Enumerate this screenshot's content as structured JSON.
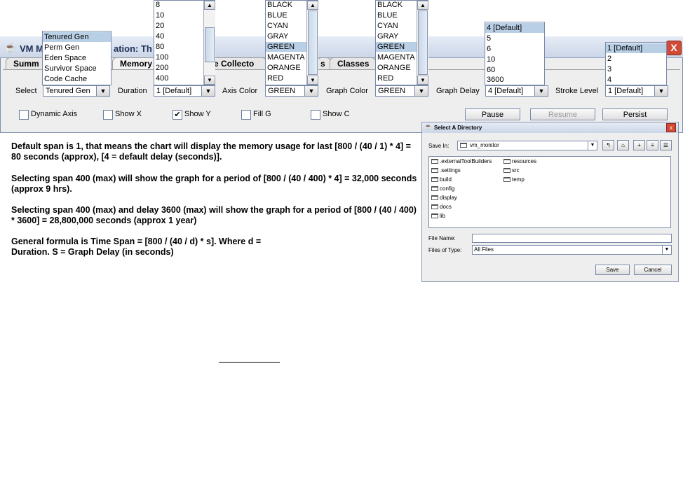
{
  "window": {
    "title_left": "VM M",
    "title_right": "ation: Th",
    "close_glyph": "X"
  },
  "tabs": [
    "Summ",
    "Memory",
    "age Collecto",
    "s",
    "Classes"
  ],
  "controls": {
    "select_label": "Select",
    "select_value": "Tenured Gen",
    "duration_label": "Duration",
    "duration_value": "1 [Default]",
    "axis_color_label": "Axis Color",
    "axis_color_value": "GREEN",
    "graph_color_label": "Graph Color",
    "graph_color_value": "GREEN",
    "graph_delay_label": "Graph Delay",
    "graph_delay_value": "4 [Default]",
    "stroke_level_label": "Stroke Level",
    "stroke_level_value": "1 [Default]"
  },
  "checkboxes": [
    {
      "label": "Dynamic Axis",
      "checked": false
    },
    {
      "label": "Show X",
      "checked": false
    },
    {
      "label": "Show Y",
      "checked": true
    },
    {
      "label": "Fill G",
      "checked": false
    },
    {
      "label": "Show C",
      "checked": false
    }
  ],
  "check_glyph": "✔",
  "buttons": {
    "pause": "Pause",
    "resume": "Resume",
    "persist": "Persist"
  },
  "dropdowns": {
    "select": [
      "Tenured Gen",
      "Perm Gen",
      "Eden Space",
      "Survivor Space",
      "Code Cache"
    ],
    "duration": [
      "8",
      "10",
      "20",
      "40",
      "80",
      "100",
      "200",
      "400"
    ],
    "axis_color": [
      "BLACK",
      "BLUE",
      "CYAN",
      "GRAY",
      "GREEN",
      "MAGENTA",
      "ORANGE",
      "RED"
    ],
    "graph_color": [
      "BLACK",
      "BLUE",
      "CYAN",
      "GRAY",
      "GREEN",
      "MAGENTA",
      "ORANGE",
      "RED"
    ],
    "graph_delay": [
      "4 [Default]",
      "5",
      "6",
      "10",
      "60",
      "3600"
    ],
    "stroke_level": [
      "1 [Default]",
      "2",
      "3",
      "4"
    ]
  },
  "description": [
    "Default span is 1, that means the chart will display the memory usage for last [800 / (40 / 1) * 4] = 80 seconds (approx), [4 = default delay (seconds)].",
    "Selecting span 400 (max) will show the graph for a period of [800 / (40 / 400) * 4] = 32,000 seconds (approx 9 hrs).",
    "Selecting span 400 (max) and delay 3600 (max) will show the graph for a period of [800 / (40 / 400) * 3600] = 28,800,000 seconds (approx 1 year)",
    "General formula is Time Span = [800 / (40 / d) * s]. Where d = Duration. S = Graph Delay (in seconds)"
  ],
  "file_chooser": {
    "title": "Select A Directory",
    "save_in_label": "Save In:",
    "save_in_value": "vm_monitor",
    "folders_col1": [
      ".externalToolBuilders",
      ".settings",
      "build",
      "config",
      "display",
      "docs",
      "lib"
    ],
    "folders_col2": [
      "resources",
      "src",
      "temp"
    ],
    "file_name_label": "File Name:",
    "file_name_value": "",
    "files_of_type_label": "Files of Type:",
    "files_of_type_value": "All Files",
    "save_button": "Save",
    "cancel_button": "Cancel"
  }
}
